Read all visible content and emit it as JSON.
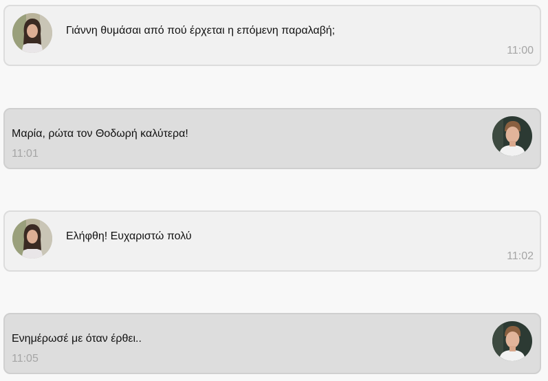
{
  "messages": [
    {
      "side": "left",
      "avatar_icon": "female-user-avatar",
      "text": "Γιάννη θυμάσαι από πού έρχεται η επόμενη παραλαβή;",
      "time": "11:00"
    },
    {
      "side": "right",
      "avatar_icon": "male-user-avatar",
      "text": "Μαρία, ρώτα τον Θοδωρή καλύτερα!",
      "time": "11:01"
    },
    {
      "side": "left",
      "avatar_icon": "female-user-avatar",
      "text": "Ελήφθη! Ευχαριστώ πολύ",
      "time": "11:02"
    },
    {
      "side": "right",
      "avatar_icon": "male-user-avatar",
      "text": "Ενημέρωσέ με όταν έρθει..",
      "time": "11:05"
    }
  ],
  "colors": {
    "page_bg": "#f8f8f8",
    "incoming_bubble": "#f1f1f1",
    "outgoing_bubble": "#dddddd",
    "timestamp": "#a5a5a5"
  }
}
